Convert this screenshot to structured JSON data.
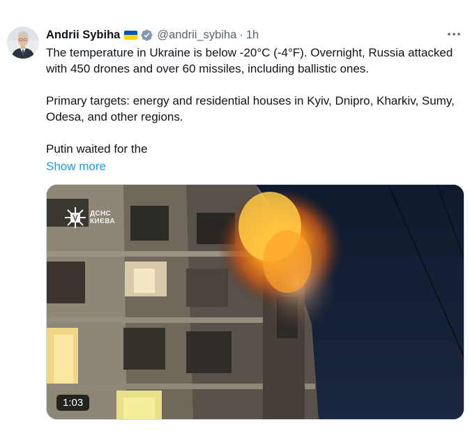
{
  "author": {
    "display_name": "Andrii Sybiha",
    "handle": "@andrii_sybiha",
    "separator": "·",
    "time_ago": "1h",
    "flag_colors": {
      "top": "#0057b7",
      "bottom": "#ffd700"
    },
    "verified_color": "#829aab",
    "avatar_icon": "profile-photo"
  },
  "menu": {
    "more_icon": "more-horizontal-icon"
  },
  "tweet": {
    "paragraphs": [
      "The temperature in Ukraine is below -20°C (-4°F). Overnight, Russia attacked with 450 drones and over 60 missiles, including ballistic ones.",
      "Primary targets: energy and residential houses in Kyiv, Dnipro, Kharkiv, Sumy, Odesa, and other regions.",
      "Putin waited for the"
    ],
    "show_more": "Show more"
  },
  "media": {
    "watermark_line1": "ДСНС",
    "watermark_line2": "КИЄВА",
    "duration": "1:03"
  },
  "colors": {
    "link": "#1d9bf0",
    "secondary_text": "#536471",
    "primary_text": "#0f1419"
  }
}
